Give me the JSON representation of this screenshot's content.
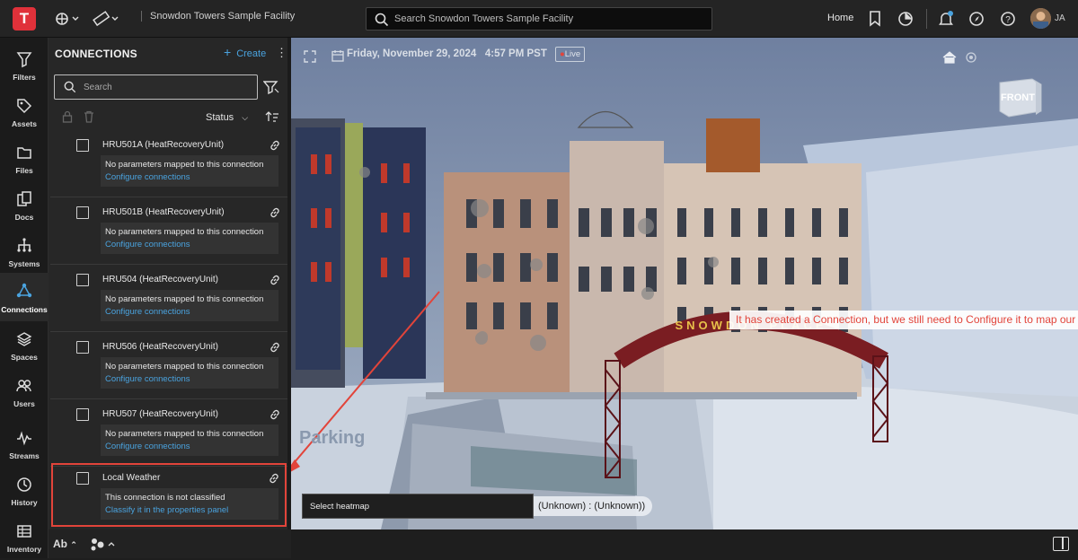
{
  "topbar": {
    "logo_letter": "T",
    "facility_name": "Snowdon Towers Sample Facility",
    "search_placeholder": "Search Snowdon Towers Sample Facility",
    "home_label": "Home",
    "user_initials": "JA"
  },
  "leftnav": {
    "items": [
      {
        "label": "Filters",
        "icon": "funnel-icon"
      },
      {
        "label": "Assets",
        "icon": "tag-icon"
      },
      {
        "label": "Files",
        "icon": "folder-icon"
      },
      {
        "label": "Docs",
        "icon": "docs-icon"
      },
      {
        "label": "Systems",
        "icon": "hierarchy-icon"
      },
      {
        "label": "Connections",
        "icon": "connections-icon",
        "active": true
      },
      {
        "label": "Spaces",
        "icon": "layers-icon"
      },
      {
        "label": "Users",
        "icon": "users-icon"
      },
      {
        "label": "Streams",
        "icon": "pulse-icon"
      },
      {
        "label": "History",
        "icon": "clock-icon"
      },
      {
        "label": "Inventory",
        "icon": "table-icon"
      }
    ]
  },
  "panel": {
    "title": "CONNECTIONS",
    "create_label": "Create",
    "search_placeholder": "Search",
    "sort_label": "Status",
    "connections": [
      {
        "name": "HRU501A (HeatRecoveryUnit)",
        "message": "No parameters mapped to this connection",
        "action": "Configure connections"
      },
      {
        "name": "HRU501B (HeatRecoveryUnit)",
        "message": "No parameters mapped to this connection",
        "action": "Configure connections"
      },
      {
        "name": "HRU504 (HeatRecoveryUnit)",
        "message": "No parameters mapped to this connection",
        "action": "Configure connections"
      },
      {
        "name": "HRU506 (HeatRecoveryUnit)",
        "message": "No parameters mapped to this connection",
        "action": "Configure connections"
      },
      {
        "name": "HRU507 (HeatRecoveryUnit)",
        "message": "No parameters mapped to this connection",
        "action": "Configure connections"
      },
      {
        "name": "Local Weather",
        "message": "This connection is not classified",
        "action": "Classify it in the properties panel"
      }
    ],
    "bottom_label": "Ab"
  },
  "viewer": {
    "date": "Friday, November 29, 2024",
    "time": "4:57 PM PST",
    "live_label": "Live",
    "viewcube_label": "FRONT",
    "heatmap_label": "Select heatmap",
    "heatmap_value": "(Unknown) : (Unknown))",
    "callout": "It has created a Connection, but we still need to Configure it to map our incoming data",
    "sign_text": "SNOWDON PLACE",
    "parking_text": "Parking"
  },
  "colors": {
    "accent_blue": "#4aa3df",
    "highlight_red": "#e2443a",
    "brand_red": "#e0313a"
  }
}
